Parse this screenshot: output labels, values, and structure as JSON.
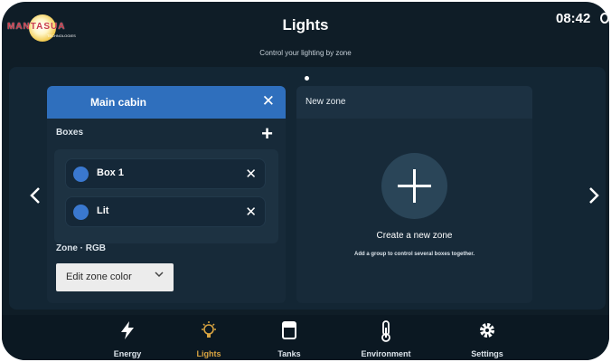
{
  "app": {
    "logo_text": "MANTASUA",
    "logo_subtext": "TECHNOLOGIES",
    "title": "Lights",
    "subtitle": "Control your lighting by zone",
    "clock": "08:42"
  },
  "carousel": {
    "prev_icon": "chevron-left-icon",
    "next_icon": "chevron-right-icon",
    "page_dots": 1
  },
  "zone": {
    "name": "Main cabin",
    "header_color": "#2f6fbd",
    "boxes_label": "Boxes",
    "boxes": [
      {
        "label": "Box 1",
        "dot_color": "#3a78cf"
      },
      {
        "label": "Lit",
        "dot_color": "#3a78cf"
      }
    ],
    "type_label": "Zone · RGB",
    "edit_color_label": "Edit zone color"
  },
  "new_zone": {
    "title": "New zone",
    "create_label": "Create a new zone",
    "create_desc": "Add a group to control several boxes together."
  },
  "nav": {
    "items": [
      {
        "label": "Energy",
        "icon": "lightning-icon",
        "active": false
      },
      {
        "label": "Lights",
        "icon": "bulb-icon",
        "active": true
      },
      {
        "label": "Tanks",
        "icon": "tank-icon",
        "active": false
      },
      {
        "label": "Environment",
        "icon": "thermometer-icon",
        "active": false
      },
      {
        "label": "Settings",
        "icon": "gear-icon",
        "active": false
      }
    ],
    "active_color": "#d9a441"
  }
}
